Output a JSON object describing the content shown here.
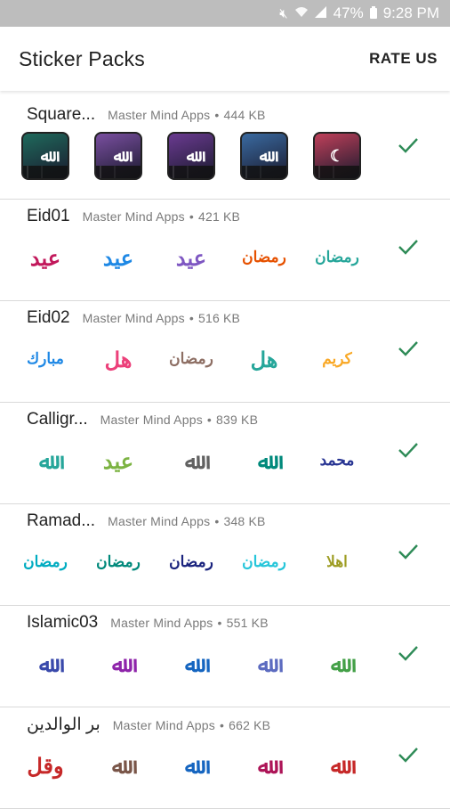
{
  "status_bar": {
    "battery": "47%",
    "time": "9:28 PM",
    "icons": [
      "mute-icon",
      "wifi-icon",
      "signal-icon",
      "battery-icon"
    ]
  },
  "header": {
    "title": "Sticker Packs",
    "rate_label": "RATE US"
  },
  "colors": {
    "check": "#2e8b57",
    "divider": "#d9d9d9",
    "meta": "#7a7a7a"
  },
  "packs": [
    {
      "name": "Square...",
      "publisher": "Master Mind Apps",
      "size": "444 KB",
      "added": true,
      "stickers": [
        {
          "glyph": "ﷲ",
          "bg": "#1f6a5c"
        },
        {
          "glyph": "ﷲ",
          "bg": "#7a4fa0"
        },
        {
          "glyph": "ﷲ",
          "bg": "#6a3a90"
        },
        {
          "glyph": "ﷲ",
          "bg": "#3a6aa0"
        },
        {
          "glyph": "☾",
          "bg": "#c0405a"
        }
      ]
    },
    {
      "name": "Eid01",
      "publisher": "Master Mind Apps",
      "size": "421 KB",
      "added": true,
      "stickers": [
        {
          "glyph": "عيد",
          "color": "#c2185b"
        },
        {
          "glyph": "عيد",
          "color": "#1e88e5"
        },
        {
          "glyph": "عيد",
          "color": "#7e57c2"
        },
        {
          "glyph": "رمضان",
          "color": "#e65100"
        },
        {
          "glyph": "رمضان",
          "color": "#26a69a"
        }
      ]
    },
    {
      "name": "Eid02",
      "publisher": "Master Mind Apps",
      "size": "516 KB",
      "added": true,
      "stickers": [
        {
          "glyph": "مبارك",
          "color": "#1e88e5"
        },
        {
          "glyph": "هل",
          "color": "#ec407a"
        },
        {
          "glyph": "رمضان",
          "color": "#8d6e63"
        },
        {
          "glyph": "هل",
          "color": "#26a69a"
        },
        {
          "glyph": "كريم",
          "color": "#f9a825"
        }
      ]
    },
    {
      "name": "Calligr...",
      "publisher": "Master Mind Apps",
      "size": "839 KB",
      "added": true,
      "stickers": [
        {
          "glyph": "ﷲ",
          "color": "#26a69a"
        },
        {
          "glyph": "عيد",
          "color": "#7cb342"
        },
        {
          "glyph": "ﷲ",
          "color": "#616161"
        },
        {
          "glyph": "ﷲ",
          "color": "#00897b"
        },
        {
          "glyph": "محمد",
          "color": "#283593"
        }
      ]
    },
    {
      "name": "Ramad...",
      "publisher": "Master Mind Apps",
      "size": "348 KB",
      "added": true,
      "stickers": [
        {
          "glyph": "رمضان",
          "color": "#00acc1"
        },
        {
          "glyph": "رمضان",
          "color": "#00897b"
        },
        {
          "glyph": "رمضان",
          "color": "#1a237e"
        },
        {
          "glyph": "رمضان",
          "color": "#26c6da"
        },
        {
          "glyph": "اهلا",
          "color": "#9e9d24"
        }
      ]
    },
    {
      "name": "Islamic03",
      "publisher": "Master Mind Apps",
      "size": "551 KB",
      "added": true,
      "stickers": [
        {
          "glyph": "ﷲ",
          "color": "#3949ab"
        },
        {
          "glyph": "ﷲ",
          "color": "#8e24aa"
        },
        {
          "glyph": "ﷲ",
          "color": "#1565c0"
        },
        {
          "glyph": "ﷲ",
          "color": "#5c6bc0"
        },
        {
          "glyph": "ﷲ",
          "color": "#43a047"
        }
      ]
    },
    {
      "name": "بر الوالدين",
      "publisher": "Master Mind Apps",
      "size": "662 KB",
      "added": true,
      "stickers": [
        {
          "glyph": "وقل",
          "color": "#c62828"
        },
        {
          "glyph": "ﷲ",
          "color": "#795548"
        },
        {
          "glyph": "ﷲ",
          "color": "#1565c0"
        },
        {
          "glyph": "ﷲ",
          "color": "#ad1457"
        },
        {
          "glyph": "ﷲ",
          "color": "#c62828"
        }
      ]
    }
  ]
}
